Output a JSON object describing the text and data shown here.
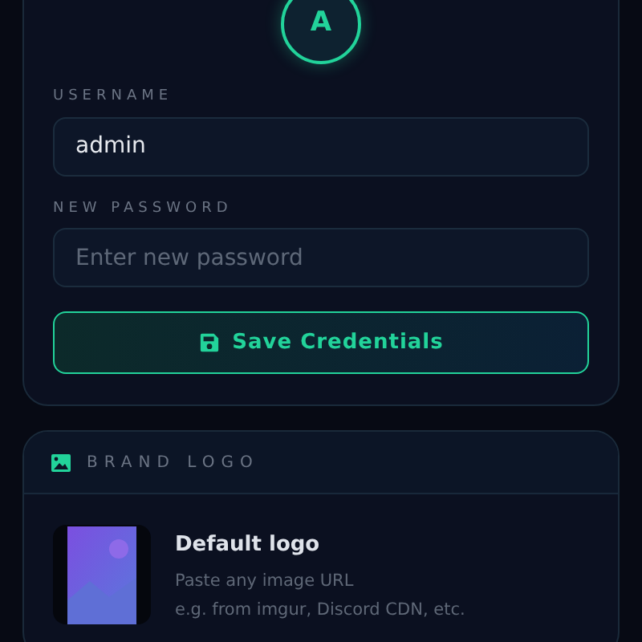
{
  "profile": {
    "avatar_initial": "A"
  },
  "credentials": {
    "username_label": "USERNAME",
    "username": "admin",
    "password_label": "NEW PASSWORD",
    "password_placeholder": "Enter new password",
    "save_button": "Save Credentials"
  },
  "brand_logo": {
    "title": "BRAND LOGO",
    "name": "Default logo",
    "hint_1": "Paste any image URL",
    "hint_2": "e.g. from imgur, Discord CDN, etc."
  }
}
